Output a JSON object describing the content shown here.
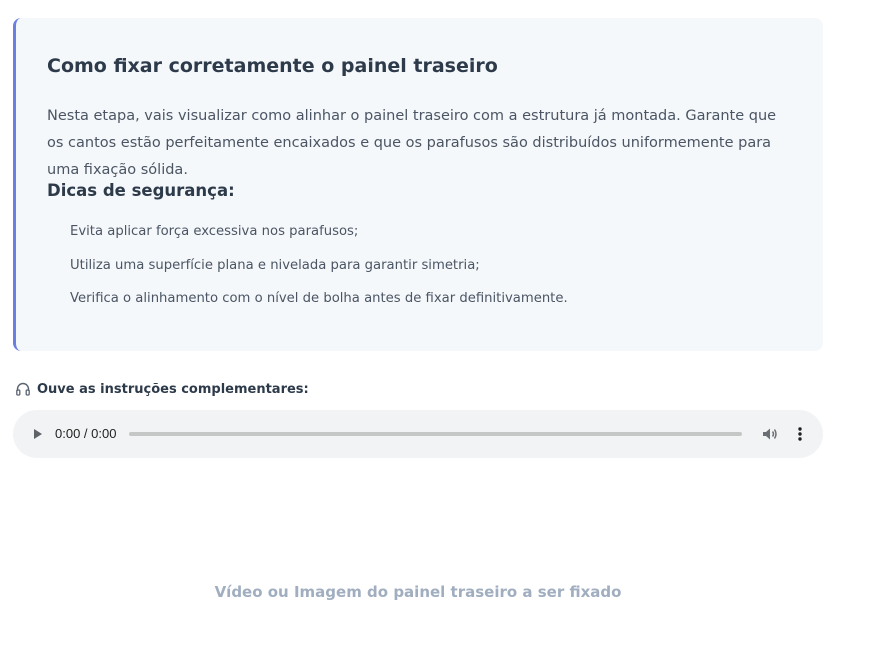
{
  "card": {
    "title": "Como fixar corretamente o painel traseiro",
    "description": "Nesta etapa, vais visualizar como alinhar o painel traseiro com a estrutura já montada. Garante que os cantos estão perfeitamente encaixados e que os parafusos são distribuídos uniformemente para uma fixação sólida.",
    "tips_title": "Dicas de segurança:",
    "tips": [
      "Evita aplicar força excessiva nos parafusos;",
      "Utiliza uma superfície plana e nivelada para garantir simetria;",
      "Verifica o alinhamento com o nível de bolha antes de fixar definitivamente."
    ],
    "accent_color": "#6b7fe0"
  },
  "audio": {
    "label": "Ouve as instruções complementares:",
    "label_icon": "headphones-icon",
    "time_display": "0:00 / 0:00",
    "progress": 0
  },
  "media": {
    "caption": "Vídeo ou Imagem do painel traseiro a ser fixado"
  }
}
